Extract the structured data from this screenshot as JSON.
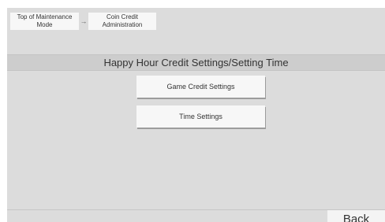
{
  "breadcrumb": {
    "items": [
      {
        "label": "Top of Maintenance\nMode"
      },
      {
        "label": "Coin Credit\nAdministration"
      }
    ],
    "separator": "→"
  },
  "header": {
    "title": "Happy Hour Credit Settings/Setting Time"
  },
  "menu": {
    "game_credit_label": "Game Credit Settings",
    "time_settings_label": "Time Settings"
  },
  "footer": {
    "back_label": "Back"
  },
  "colors": {
    "screen_background": "#dcdcdc",
    "title_bar": "#cdcdcd",
    "button_face": "#f7f7f7",
    "text": "#333333"
  }
}
